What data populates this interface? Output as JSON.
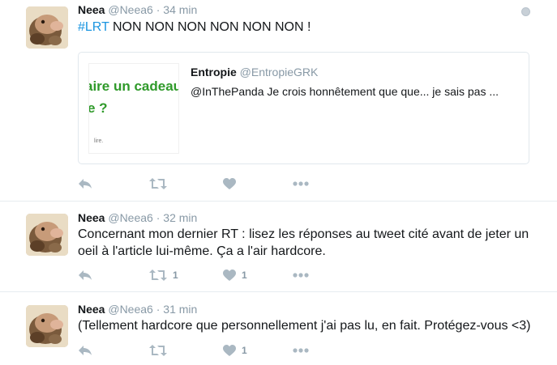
{
  "tweets": [
    {
      "name": "Neea",
      "handle": "@Neea6",
      "separator": "·",
      "time": "34 min",
      "hashtag": "#LRT",
      "text": " NON NON NON NON NON NON !",
      "quote": {
        "name": "Entropie",
        "handle": "@EntropieGRK",
        "text": "@InThePanda Je crois honnêtement que que... je sais pas ...",
        "image_line1": "aire un cadeau",
        "image_line2": "e ?",
        "image_small": "lire."
      },
      "retweets": "",
      "likes": ""
    },
    {
      "name": "Neea",
      "handle": "@Neea6",
      "separator": "·",
      "time": "32 min",
      "text": "Concernant mon dernier RT : lisez les réponses au tweet cité avant de jeter un oeil à l'article lui-même. Ça a l'air hardcore.",
      "retweets": "1",
      "likes": "1"
    },
    {
      "name": "Neea",
      "handle": "@Neea6",
      "separator": "·",
      "time": "31 min",
      "text": "(Tellement hardcore que personnellement j'ai pas lu, en fait. Protégez-vous <3)",
      "retweets": "",
      "likes": "1"
    }
  ],
  "colors": {
    "hashtag": "#1b95e0",
    "meta": "#8899a6",
    "icon": "#aab8c2",
    "divider": "#e6ecf0"
  },
  "icons": [
    "globe-icon",
    "reply-icon",
    "retweet-icon",
    "like-icon",
    "more-icon"
  ]
}
